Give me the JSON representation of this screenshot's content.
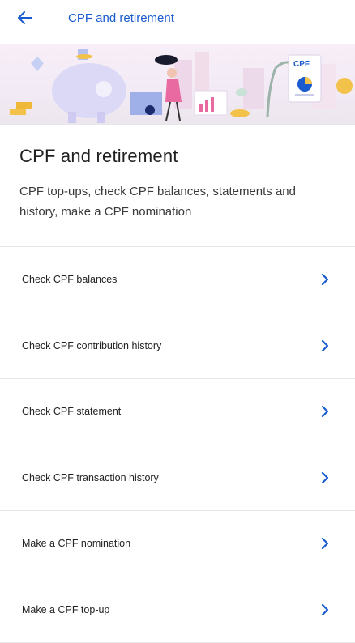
{
  "header": {
    "back_icon": "arrow-left-icon",
    "title": "CPF and retirement"
  },
  "banner": {
    "doc_label": "CPF",
    "colors": {
      "primary": "#1a5bd0",
      "accent_pink": "#f0a6c8",
      "gold": "#f3c24b"
    }
  },
  "intro": {
    "title": "CPF and retirement",
    "description": "CPF top-ups, check CPF balances, statements and history, make a CPF nomination"
  },
  "items": [
    {
      "label": "Check CPF balances",
      "icon": "chevron-right-icon"
    },
    {
      "label": "Check CPF contribution history",
      "icon": "chevron-right-icon"
    },
    {
      "label": "Check CPF statement",
      "icon": "chevron-right-icon"
    },
    {
      "label": "Check CPF transaction history",
      "icon": "chevron-right-icon"
    },
    {
      "label": "Make a CPF nomination",
      "icon": "chevron-right-icon"
    },
    {
      "label": "Make a CPF top-up",
      "icon": "chevron-right-icon"
    }
  ]
}
